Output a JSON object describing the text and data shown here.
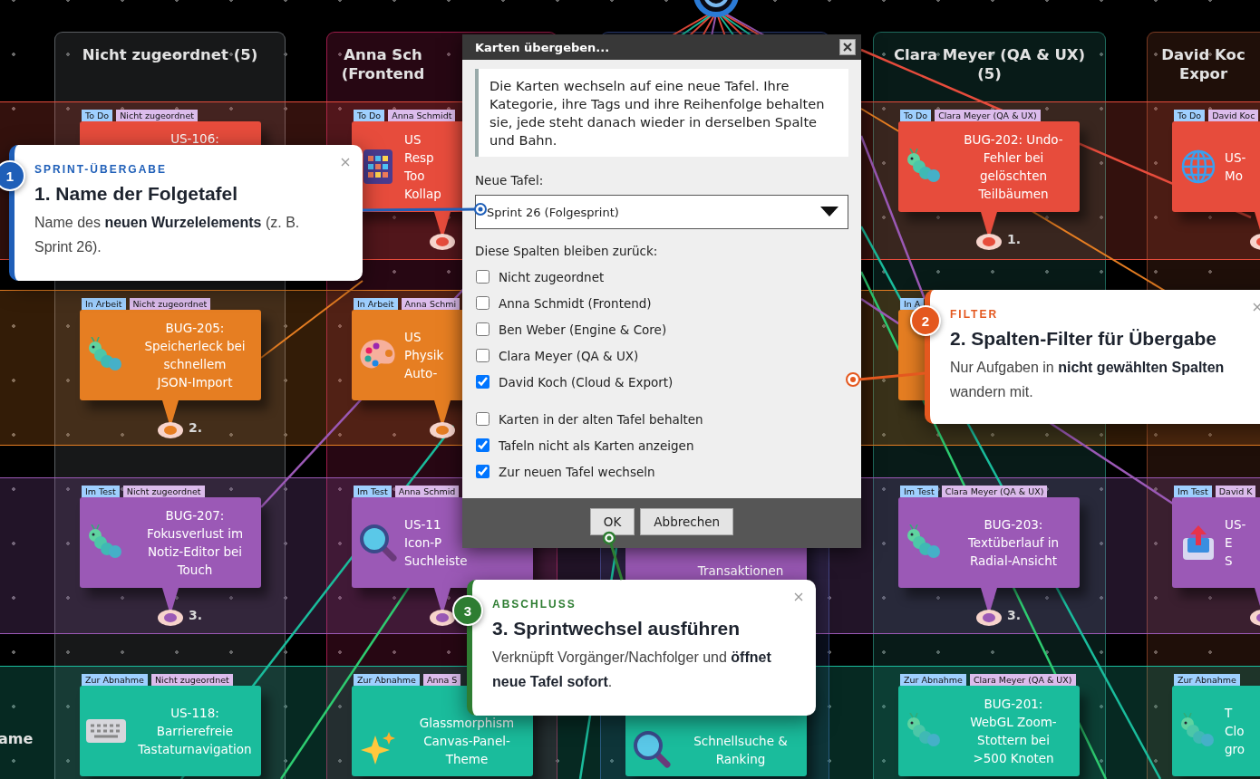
{
  "columns": [
    {
      "title": [
        "Nicht zugeordnet (5)"
      ],
      "color": "#5a5e62"
    },
    {
      "title": [
        "Anna Sch",
        "(Frontend"
      ],
      "color": "#9c1c4a"
    },
    {
      "color": "#2c3f78"
    },
    {
      "title": [
        "Clara Meyer (QA & UX)",
        "(5)"
      ],
      "color": "#1f6b5e"
    },
    {
      "title": [
        "David Koc",
        "Expor"
      ],
      "color": "#7a3a22"
    }
  ],
  "lanes": [
    {
      "color": "#e74c3c",
      "cells": [
        {
          "tags": [
            {
              "label": "To Do",
              "kind": "status"
            },
            {
              "label": "Nicht zugeordnet",
              "kind": "person"
            }
          ],
          "lines": [
            "US-106:"
          ]
        },
        {
          "tags": [
            {
              "label": "To Do",
              "kind": "status"
            },
            {
              "label": "Anna Schmidt",
              "kind": "person"
            }
          ],
          "lines": [
            "US",
            "Resp",
            "Too",
            "Kollap"
          ],
          "pin": true
        },
        null,
        {
          "tags": [
            {
              "label": "To Do",
              "kind": "status"
            },
            {
              "label": "Clara Meyer (QA & UX)",
              "kind": "person"
            }
          ],
          "lines": [
            "BUG-202: Undo-",
            "Fehler bei",
            "gelöschten",
            "Teilbäumen"
          ],
          "pin": true,
          "order": "1."
        },
        {
          "tags": [
            {
              "label": "To Do",
              "kind": "status"
            },
            {
              "label": "David Koc",
              "kind": "person"
            }
          ],
          "lines": [
            "US-",
            "Mo"
          ],
          "pin": true
        }
      ]
    },
    {
      "color": "#e67e22",
      "cells": [
        {
          "tags": [
            {
              "label": "In Arbeit",
              "kind": "status"
            },
            {
              "label": "Nicht zugeordnet",
              "kind": "person"
            }
          ],
          "lines": [
            "BUG-205:",
            "Speicherleck bei",
            "schnellem",
            "JSON-Import"
          ],
          "pin": true,
          "order": "2."
        },
        {
          "tags": [
            {
              "label": "In Arbeit",
              "kind": "status"
            },
            {
              "label": "Anna Schmi",
              "kind": "person"
            }
          ],
          "lines": [
            "US",
            "Physik",
            "Auto-"
          ],
          "pin": true
        },
        null,
        {
          "tags": [
            {
              "label": "In A",
              "kind": "status"
            }
          ]
        },
        null
      ]
    },
    {
      "color": "#9b59b6",
      "cells": [
        {
          "tags": [
            {
              "label": "Im Test",
              "kind": "status"
            },
            {
              "label": "Nicht zugeordnet",
              "kind": "person"
            }
          ],
          "lines": [
            "BUG-207:",
            "Fokusverlust im",
            "Notiz-Editor bei",
            "Touch"
          ],
          "pin": true,
          "order": "3."
        },
        {
          "tags": [
            {
              "label": "Im Test",
              "kind": "status"
            },
            {
              "label": "Anna Schmid",
              "kind": "person"
            }
          ],
          "lines": [
            "US-11",
            "Icon-P",
            "Suchleiste"
          ],
          "pin": true
        },
        {
          "lines": [
            "Transaktionen"
          ]
        },
        {
          "tags": [
            {
              "label": "Im Test",
              "kind": "status"
            },
            {
              "label": "Clara Meyer (QA & UX)",
              "kind": "person"
            }
          ],
          "lines": [
            "BUG-203:",
            "Textüberlauf in",
            "Radial-Ansicht"
          ],
          "pin": true,
          "order": "3."
        },
        {
          "tags": [
            {
              "label": "Im Test",
              "kind": "status"
            },
            {
              "label": "David K",
              "kind": "person"
            }
          ],
          "lines": [
            "US-",
            "E",
            "S"
          ],
          "pin": true
        }
      ]
    },
    {
      "color": "#1abc9c",
      "label": "ame",
      "cells": [
        {
          "tags": [
            {
              "label": "Zur Abnahme",
              "kind": "status"
            },
            {
              "label": "Nicht zugeordnet",
              "kind": "person"
            }
          ],
          "lines": [
            "US-118:",
            "Barrierefreie",
            "Tastaturnavigation"
          ]
        },
        {
          "tags": [
            {
              "label": "Zur Abnahme",
              "kind": "status"
            },
            {
              "label": "Anna S",
              "kind": "person"
            }
          ],
          "lines": [
            "Glassmorphism",
            "Canvas-Panel-",
            "Theme"
          ]
        },
        {
          "lines": [
            "Schnellsuche &",
            "Ranking"
          ]
        },
        {
          "tags": [
            {
              "label": "Zur Abnahme",
              "kind": "status"
            },
            {
              "label": "Clara Meyer (QA & UX)",
              "kind": "person"
            }
          ],
          "lines": [
            "BUG-201:",
            "WebGL Zoom-",
            "Stottern bei",
            ">500 Knoten"
          ]
        },
        {
          "tags": [
            {
              "label": "Zur Abnahme",
              "kind": "status"
            }
          ],
          "lines": [
            "T",
            "Clo",
            "gro"
          ]
        }
      ]
    }
  ],
  "dialog": {
    "title": "Karten übergeben...",
    "info": "Die Karten wechseln auf eine neue Tafel. Ihre Kategorie, ihre Tags und ihre Reihenfolge behalten sie, jede steht danach wieder in derselben Spalte und Bahn.",
    "board_label": "Neue Tafel:",
    "board_select": {
      "value": "Sprint 26 (Folgesprint)"
    },
    "columns_label": "Diese Spalten bleiben zurück:",
    "column_options": [
      {
        "label": "Nicht zugeordnet",
        "checked": false
      },
      {
        "label": "Anna Schmidt (Frontend)",
        "checked": false
      },
      {
        "label": "Ben Weber (Engine & Core)",
        "checked": false
      },
      {
        "label": "Clara Meyer (QA & UX)",
        "checked": false
      },
      {
        "label": "David Koch (Cloud & Export)",
        "checked": true
      }
    ],
    "options": [
      {
        "label": "Karten in der alten Tafel behalten",
        "checked": false
      },
      {
        "label": "Tafeln nicht als Karten anzeigen",
        "checked": true
      },
      {
        "label": "Zur neuen Tafel wechseln",
        "checked": true
      }
    ],
    "buttons": [
      "OK",
      "Abbrechen"
    ]
  },
  "callouts": [
    {
      "number": "1",
      "kicker": "SPRINT-ÜBERGABE",
      "title": "1. Name der Folgetafel",
      "body": "Name des **neuen Wurzelelements** (z. B. Sprint 26).",
      "color": "#1f5fb8"
    },
    {
      "number": "2",
      "kicker": "FILTER",
      "title": "2. Spalten-Filter für Übergabe",
      "body": "Nur Aufgaben in **nicht gewählten Spalten** wandern mit.",
      "color": "#e4581f"
    },
    {
      "number": "3",
      "kicker": "ABSCHLUSS",
      "title": "3. Sprintwechsel ausführen",
      "body": "Verknüpft Vorgänger/Nachfolger und **öffnet neue Tafel sofort**.",
      "color": "#2e7d32"
    }
  ]
}
